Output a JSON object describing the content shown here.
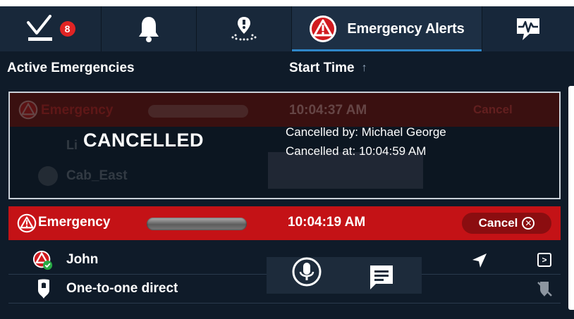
{
  "tabs": [
    {
      "name": "tasks",
      "icon": "check-tray-icon",
      "badge": "8"
    },
    {
      "name": "notifications",
      "icon": "bell-icon"
    },
    {
      "name": "location",
      "icon": "map-pin-icon"
    },
    {
      "name": "emergency-alerts",
      "icon": "alert-triangle-icon",
      "label": "Emergency Alerts",
      "selected": true
    },
    {
      "name": "health",
      "icon": "heartbeat-chat-icon"
    }
  ],
  "columns": {
    "active": "Active Emergencies",
    "start_time": "Start Time"
  },
  "cancelled_card": {
    "status": "CANCELLED",
    "title": "Emergency",
    "time": "10:04:37 AM",
    "cancel_label": "Cancel",
    "row1_label": "Li",
    "row2_label": "Cab_East",
    "cancelled_by": "Cancelled by: Michael George",
    "cancelled_at": "Cancelled at: 10:04:59 AM"
  },
  "active_card": {
    "title": "Emergency",
    "time": "10:04:19 AM",
    "cancel_label": "Cancel",
    "rows": [
      {
        "label": "John",
        "icon": "user-alert-icon"
      },
      {
        "label": "One-to-one direct",
        "icon": "private-call-icon"
      }
    ]
  },
  "colors": {
    "accent": "#2f86c8",
    "alert_red": "#c41216",
    "badge_red": "#e02424",
    "background": "#0f1b29"
  }
}
